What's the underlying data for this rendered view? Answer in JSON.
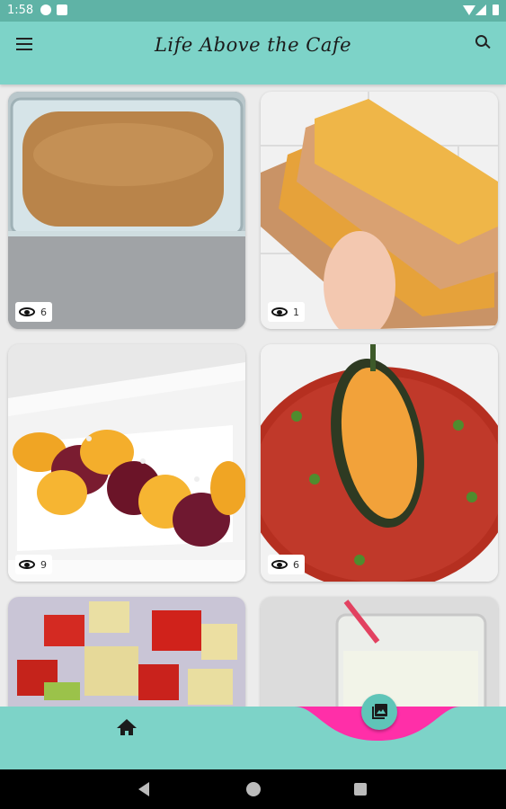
{
  "status_bar": {
    "time": "1:58"
  },
  "app_bar": {
    "title": "Life Above the Cafe"
  },
  "posts": [
    {
      "views": "6"
    },
    {
      "views": "1"
    },
    {
      "views": "9"
    },
    {
      "views": "6"
    },
    {
      "views": null
    },
    {
      "views": null
    }
  ],
  "colors": {
    "status_bar": "#5fb3a6",
    "app_bar": "#7dd3c8",
    "nav_bar": "#7dd3c8",
    "accent_wave": "#ff2fa8",
    "fab": "#5fc5b8"
  },
  "icons": {
    "menu": "menu-icon",
    "search": "search-icon",
    "views": "eye-icon",
    "home": "home-icon",
    "gallery": "gallery-icon"
  }
}
